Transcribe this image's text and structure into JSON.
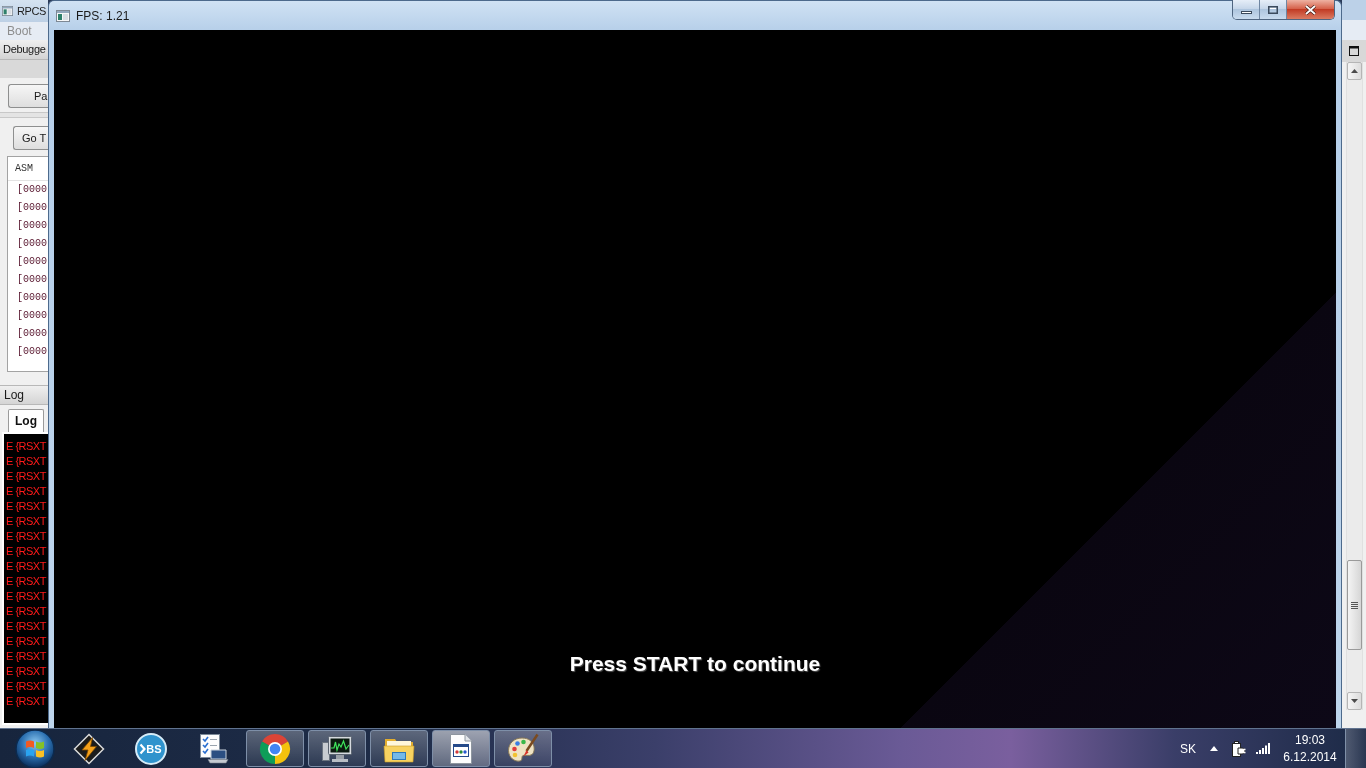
{
  "back_window": {
    "title": "RPCS",
    "menu": [
      {
        "label": "Boot",
        "disabled": true
      }
    ],
    "debugger": {
      "title": "Debugge",
      "buttons": [
        "Pa",
        "Go T"
      ],
      "asm": {
        "header": "ASM",
        "rows": [
          "[0000",
          "[0000",
          "[0000",
          "[0000",
          "[0000",
          "[0000",
          "[0000",
          "[0000",
          "[0000",
          "[0000"
        ]
      }
    },
    "log": {
      "title": "Log",
      "tabs": [
        {
          "label": "Log",
          "selected": true
        }
      ],
      "lines": [
        "E {RSXT",
        "E {RSXT",
        "E {RSXT",
        "E {RSXT",
        "E {RSXT",
        "E {RSXT",
        "E {RSXT",
        "E {RSXT",
        "E {RSXT",
        "E {RSXT",
        "E {RSXT",
        "E {RSXT",
        "E {RSXT",
        "E {RSXT",
        "E {RSXT",
        "E {RSXT",
        "E {RSXT",
        "E {RSXT"
      ]
    }
  },
  "game_window": {
    "title": "FPS: 1.21",
    "message": "Press START to continue"
  },
  "taskbar": {
    "buttons": [
      {
        "running": false,
        "selected": false
      },
      {
        "running": false,
        "selected": false,
        "label": "BS"
      },
      {
        "running": false,
        "selected": false
      },
      {
        "running": true,
        "selected": false
      },
      {
        "running": true,
        "selected": false
      },
      {
        "running": true,
        "selected": false
      },
      {
        "running": true,
        "selected": true
      },
      {
        "running": true,
        "selected": false
      }
    ],
    "tray": {
      "language": "SK",
      "time": "19:03",
      "date": "6.12.2014"
    }
  }
}
